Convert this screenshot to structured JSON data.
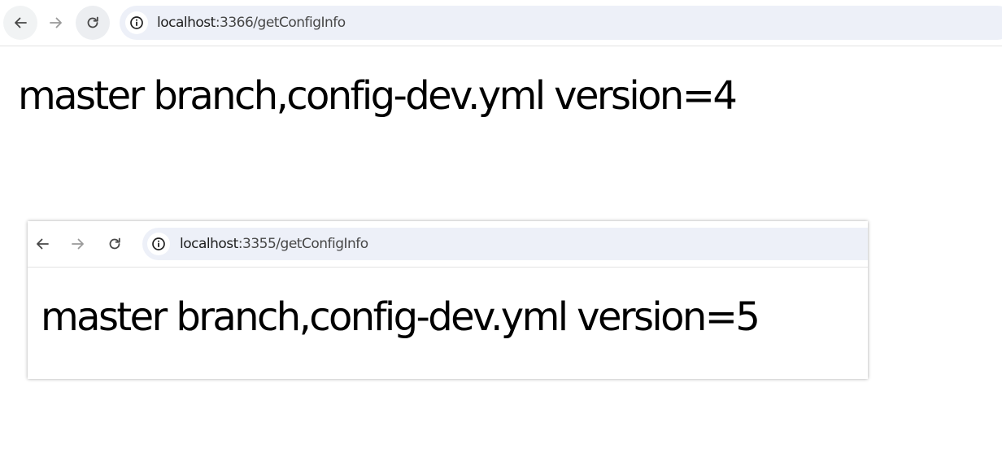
{
  "outer_browser": {
    "url_host": "localhost",
    "url_rest": ":3366/getConfigInfo",
    "page_text": "master branch,config-dev.yml version=4",
    "icons": [
      "arrow-left-icon",
      "arrow-right-icon",
      "reload-icon",
      "info-icon"
    ]
  },
  "inner_browser": {
    "url_host": "localhost",
    "url_rest": ":3355/getConfigInfo",
    "page_text": "master branch,config-dev.yml version=5",
    "icons": [
      "arrow-left-icon",
      "arrow-right-icon",
      "reload-icon",
      "info-icon"
    ]
  },
  "colors": {
    "omnibox_bg": "#edf0f8",
    "text": "#000000"
  }
}
